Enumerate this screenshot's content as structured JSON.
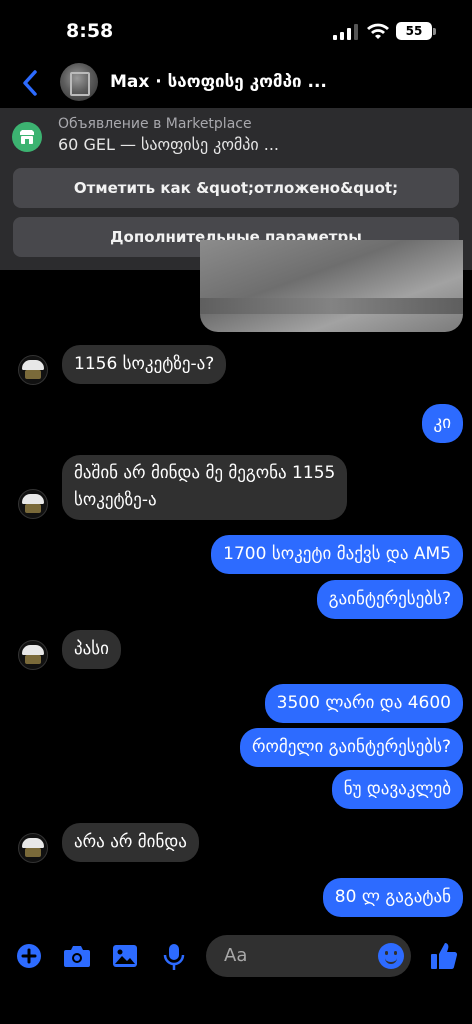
{
  "status_bar": {
    "time": "8:58",
    "battery": "55"
  },
  "header": {
    "back_icon": "chevron-left-icon",
    "title": "Max · საოფისე კომპი ..."
  },
  "marketplace": {
    "subtitle": "Объявление в Marketplace",
    "title": "60 GEL — საოფისე კომპი ...",
    "mark_button": "Отметить как &quot;отложено&quot;",
    "more_button": "Дополнительные параметры"
  },
  "messages": [
    {
      "side": "in",
      "text": "1156 სოკეტზე-ა?"
    },
    {
      "side": "out",
      "text": "კი"
    },
    {
      "side": "in",
      "lines": [
        "მაშინ არ მინდა მე მეგონა 1155",
        "სოკეტზე-ა"
      ]
    },
    {
      "side": "out",
      "text": "1700 სოკეტი მაქვს და AM5"
    },
    {
      "side": "out",
      "text": "გაინტერესებს?"
    },
    {
      "side": "in",
      "text": "პასი"
    },
    {
      "side": "out",
      "text": "3500 ლარი და 4600"
    },
    {
      "side": "out",
      "text": "რომელი გაინტერესებს?"
    },
    {
      "side": "out",
      "text": "ნუ დავაკლებ"
    },
    {
      "side": "in",
      "text": "არა არ მინდა"
    },
    {
      "side": "out",
      "text": "80 ლ გაგატან"
    }
  ],
  "composer": {
    "placeholder": "Aa",
    "icons": [
      "plus-icon",
      "camera-icon",
      "gallery-icon",
      "microphone-icon",
      "emoji-icon",
      "thumbs-up-icon"
    ]
  },
  "colors": {
    "accent": "#2d6bff",
    "incoming_bubble": "#303030",
    "panel": "#2c2c2e",
    "marketplace_green": "#3cb371"
  }
}
